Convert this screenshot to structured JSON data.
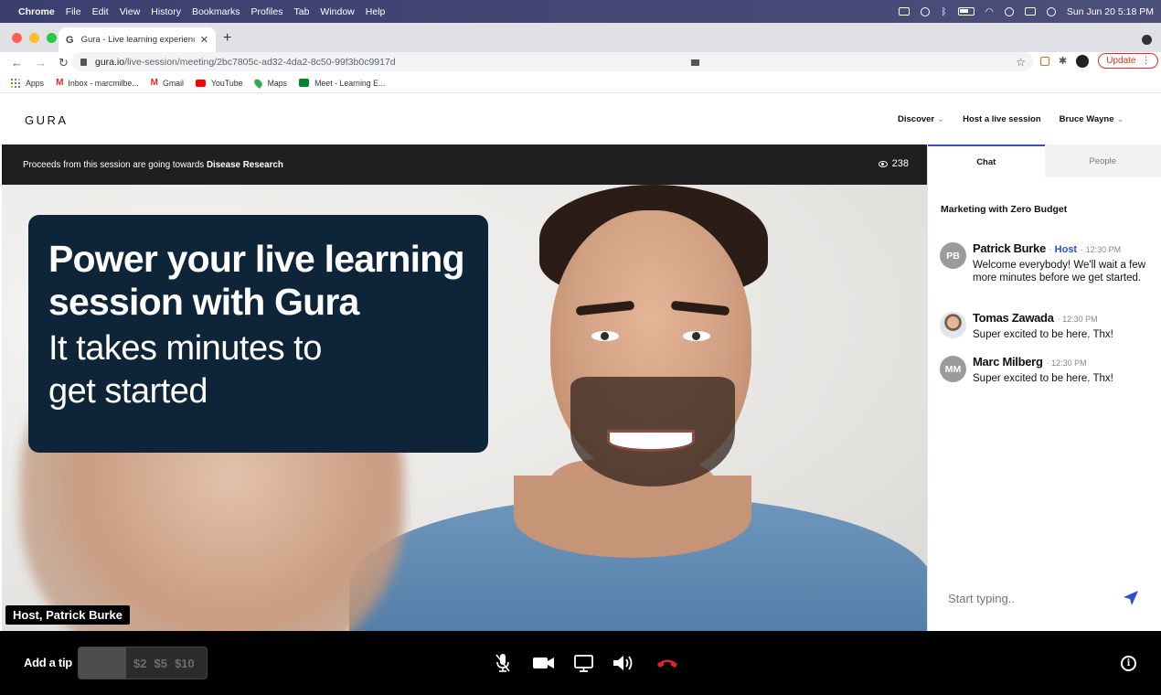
{
  "menubar": {
    "app": "Chrome",
    "items": [
      "File",
      "Edit",
      "View",
      "History",
      "Bookmarks",
      "Profiles",
      "Tab",
      "Window",
      "Help"
    ],
    "datetime": "Sun Jun 20  5:18 PM"
  },
  "browser": {
    "tab_title": "Gura - Live learning experiences",
    "url_host": "gura.io",
    "url_path": "/live-session/meeting/2bc7805c-ad32-4da2-8c50-99f3b0c9917d",
    "update_label": "Update",
    "bookmarks": [
      "Apps",
      "Inbox - marcmilbe...",
      "Gmail",
      "YouTube",
      "Maps",
      "Meet - Learning E..."
    ]
  },
  "header": {
    "logo": "GURA",
    "nav": {
      "discover": "Discover",
      "host": "Host a live session",
      "user": "Bruce Wayne"
    }
  },
  "session": {
    "banner_prefix": "Proceeds from this session are going towards ",
    "banner_cause": "Disease Research",
    "viewers": "238",
    "promo_title": "Power your live learning session with Gura",
    "promo_subtitle": "It takes minutes to get started",
    "host_label": "Host, Patrick Burke"
  },
  "panel": {
    "tabs": {
      "chat": "Chat",
      "people": "People"
    },
    "session_title": "Marketing with Zero Budget",
    "messages": [
      {
        "initials": "PB",
        "name": "Patrick Burke",
        "role": "Host",
        "time": "12:30 PM",
        "text": "Welcome everybody! We'll wait a few more minutes before we get started."
      },
      {
        "initials": "",
        "name": "Tomas Zawada",
        "role": "",
        "time": "12:30 PM",
        "text": "Super excited to be here. Thx!"
      },
      {
        "initials": "MM",
        "name": "Marc Milberg",
        "role": "",
        "time": "12:30 PM",
        "text": "Super excited to be here. Thx!"
      }
    ],
    "input_placeholder": "Start typing.."
  },
  "controls": {
    "tip_label": "Add a tip",
    "tip_amounts": [
      "$2",
      "$5",
      "$10"
    ],
    "icons": [
      "microphone-icon",
      "video-camera-icon",
      "screen-share-icon",
      "speaker-icon",
      "end-call-icon",
      "info-icon"
    ],
    "end_call_color": "#e02424",
    "accent": "#2b50d6"
  }
}
